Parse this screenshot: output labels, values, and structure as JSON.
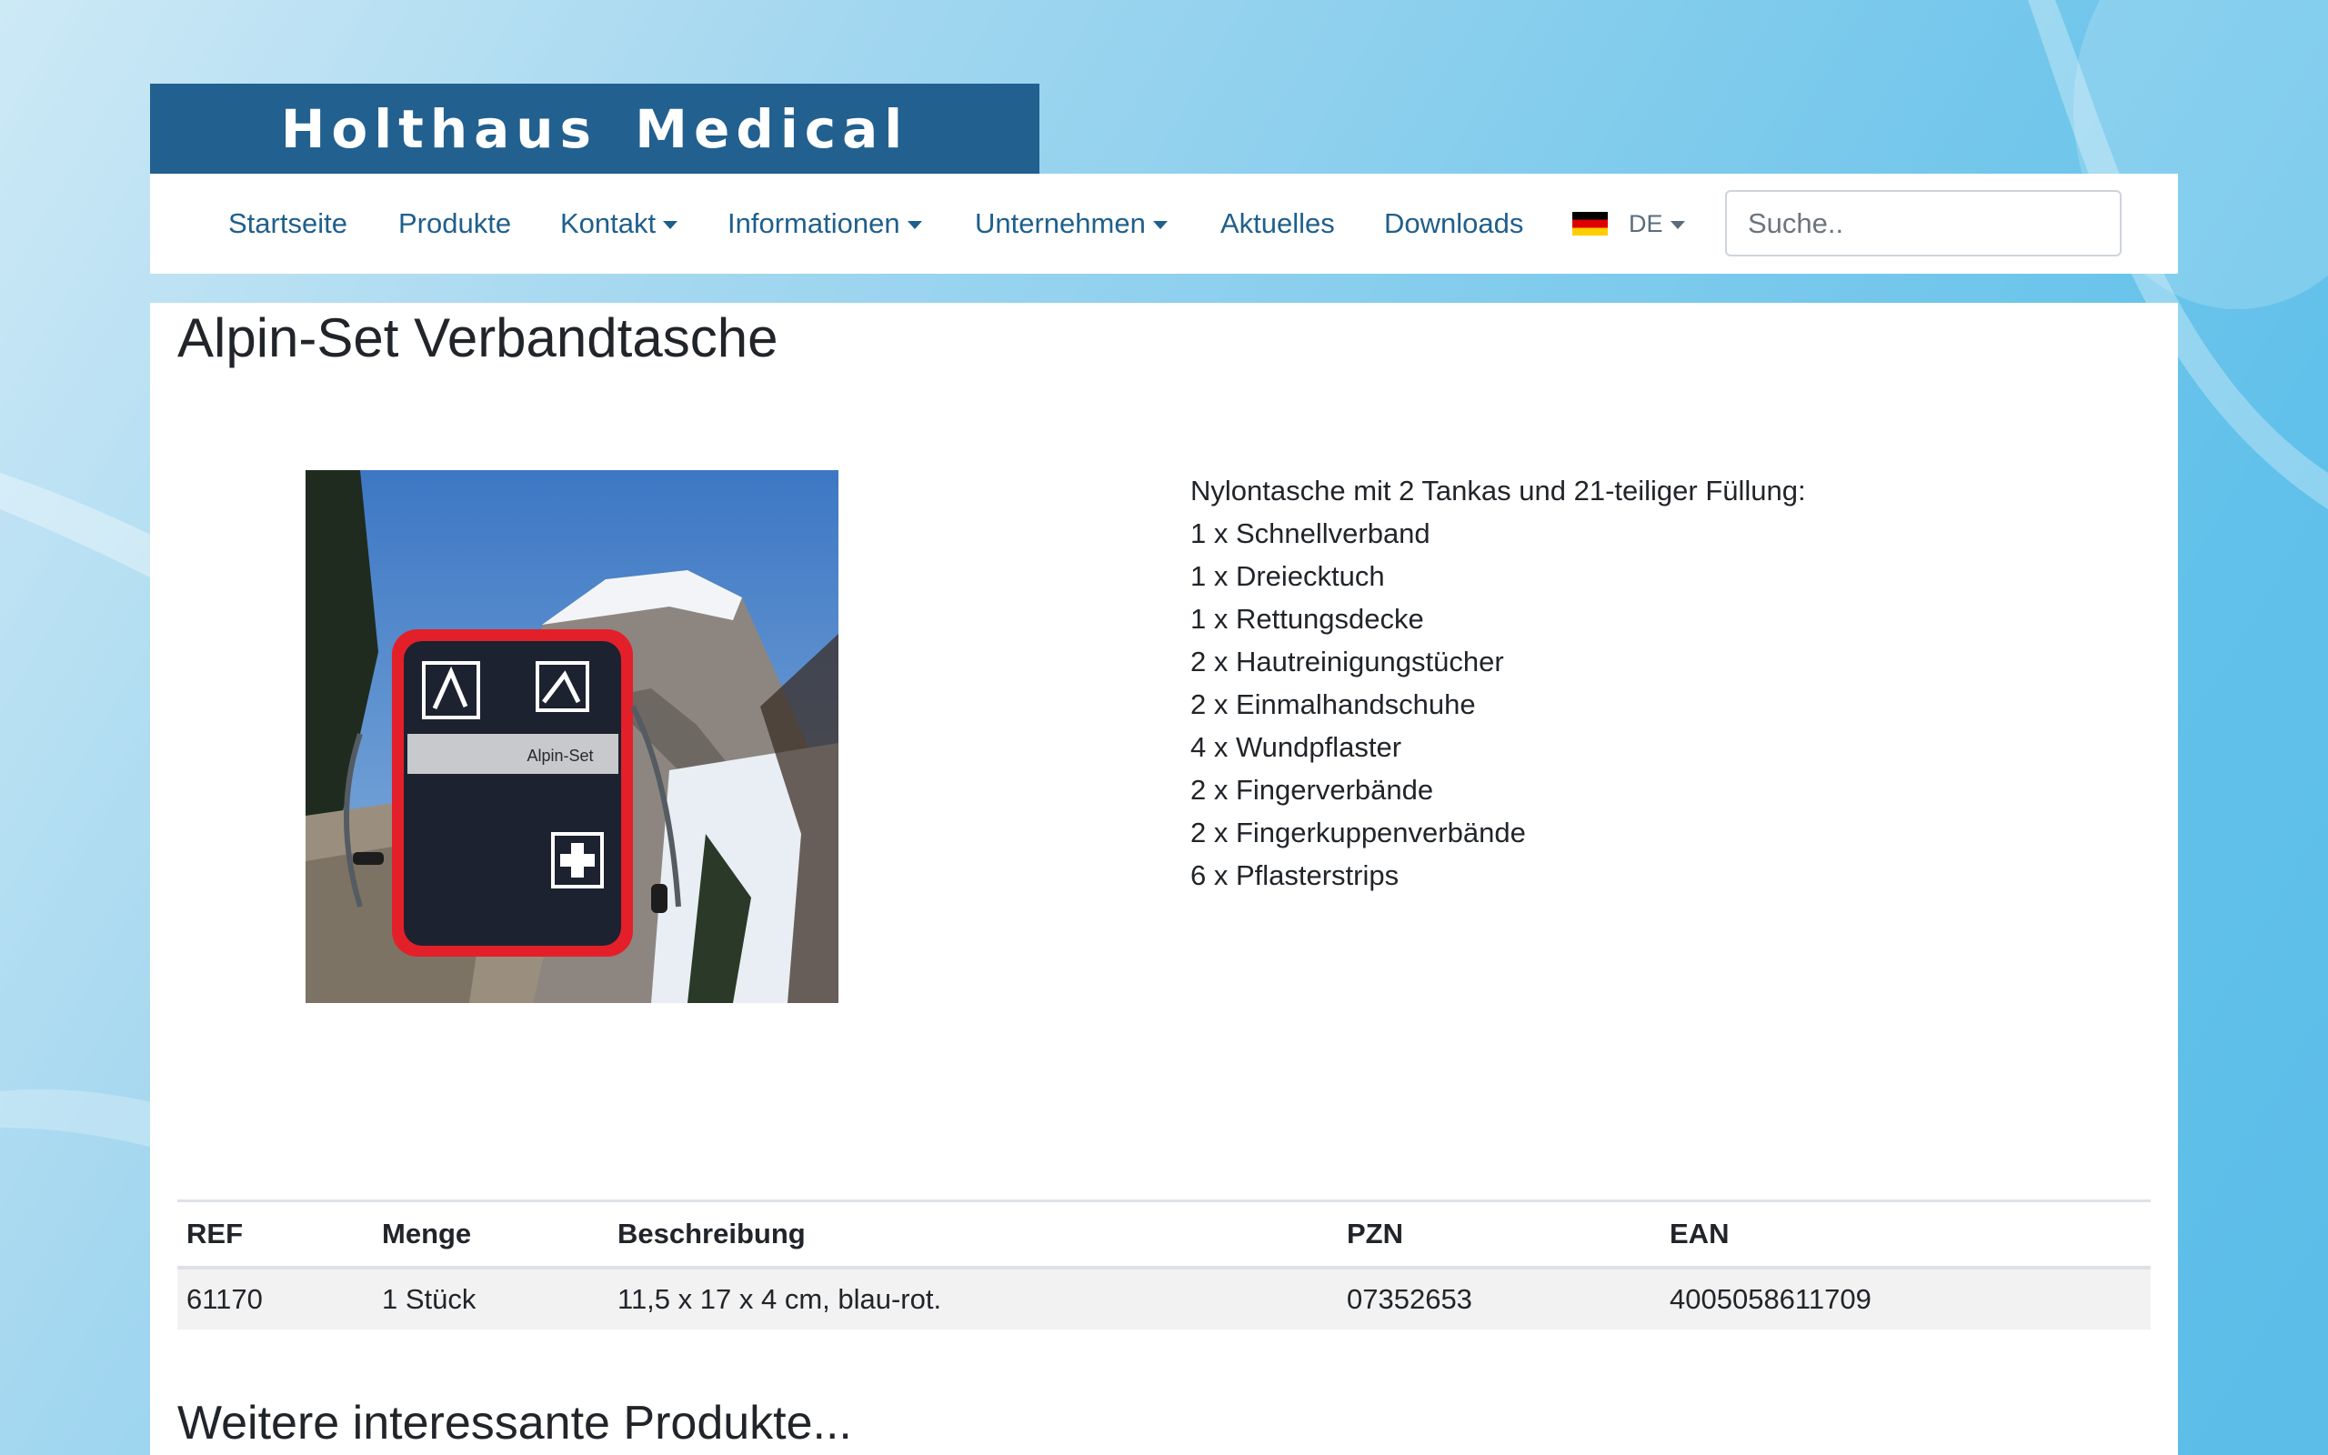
{
  "brand": {
    "logo_text": "Holthaus Medical",
    "banner_color": "#22608f"
  },
  "nav": {
    "items": [
      {
        "label": "Startseite",
        "dropdown": false
      },
      {
        "label": "Produkte",
        "dropdown": false
      },
      {
        "label": "Kontakt",
        "dropdown": true
      },
      {
        "label": "Informationen",
        "dropdown": true
      },
      {
        "label": "Unternehmen",
        "dropdown": true
      },
      {
        "label": "Aktuelles",
        "dropdown": false
      },
      {
        "label": "Downloads",
        "dropdown": false
      }
    ],
    "language": {
      "label": "DE",
      "flag": "german-flag-icon"
    },
    "search": {
      "placeholder": "Suche..",
      "value": ""
    }
  },
  "product": {
    "title": "Alpin-Set Verbandtasche",
    "image": {
      "bag_label": "Alpin-Set",
      "alt": "Alpin-Set Verbandtasche"
    },
    "description": [
      "Nylontasche mit 2 Tankas und 21-teiliger Füllung:",
      "1 x Schnellverband",
      "1 x Dreiecktuch",
      "1 x Rettungsdecke",
      "2 x Hautreinigungstücher",
      "2 x Einmalhandschuhe",
      "4 x Wundpflaster",
      "2 x Fingerverbände",
      "2 x Fingerkuppenverbände",
      "6 x Pflasterstrips"
    ]
  },
  "table": {
    "headers": [
      "REF",
      "Menge",
      "Beschreibung",
      "PZN",
      "EAN"
    ],
    "rows": [
      [
        "61170",
        "1 Stück",
        "11,5 x 17 x 4 cm, blau-rot.",
        "07352653",
        "4005058611709"
      ]
    ]
  },
  "more_products": {
    "title": "Weitere interessante Produkte..."
  },
  "colors": {
    "link": "#1f5f8c",
    "accent_red": "#e3202a"
  }
}
